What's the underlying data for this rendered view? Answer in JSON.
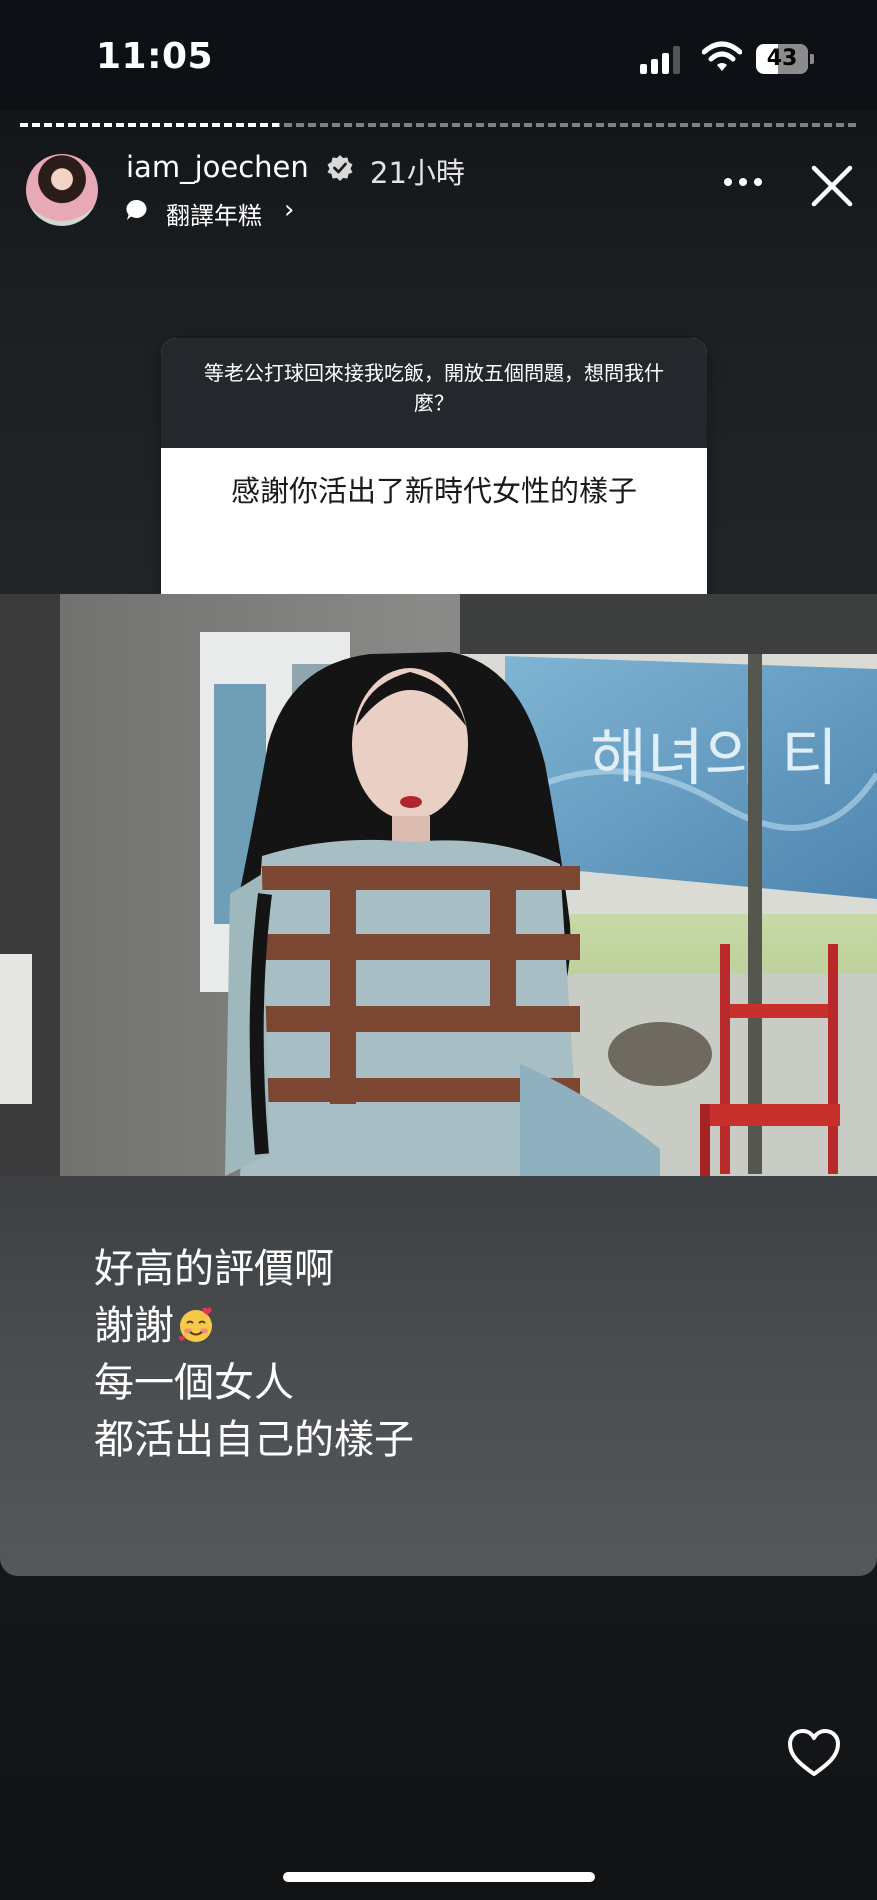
{
  "status_bar": {
    "time": "11:05",
    "battery": "43",
    "battery_level": 0.43
  },
  "story": {
    "progress_fraction": 0.31,
    "user": {
      "username": "iam_joechen",
      "time_ago": "21小時",
      "translate_label": "翻譯年糕"
    },
    "question_card": {
      "question": "等老公打球回來接我吃飯，開放五個問題，想問我什麼？",
      "answer": "感謝你活出了新時代女性的樣子"
    },
    "photo": {
      "banner_text": "해녀의 티"
    },
    "reply_lines": [
      "好高的評價啊",
      "謝謝",
      "每一個女人",
      "都活出自己的樣子"
    ],
    "reply_emoji": "smiling-face-with-hearts-icon"
  },
  "colors": {
    "background": "#0d1014",
    "card_header": "#24282c",
    "reply_panel": "#4b4e51"
  }
}
